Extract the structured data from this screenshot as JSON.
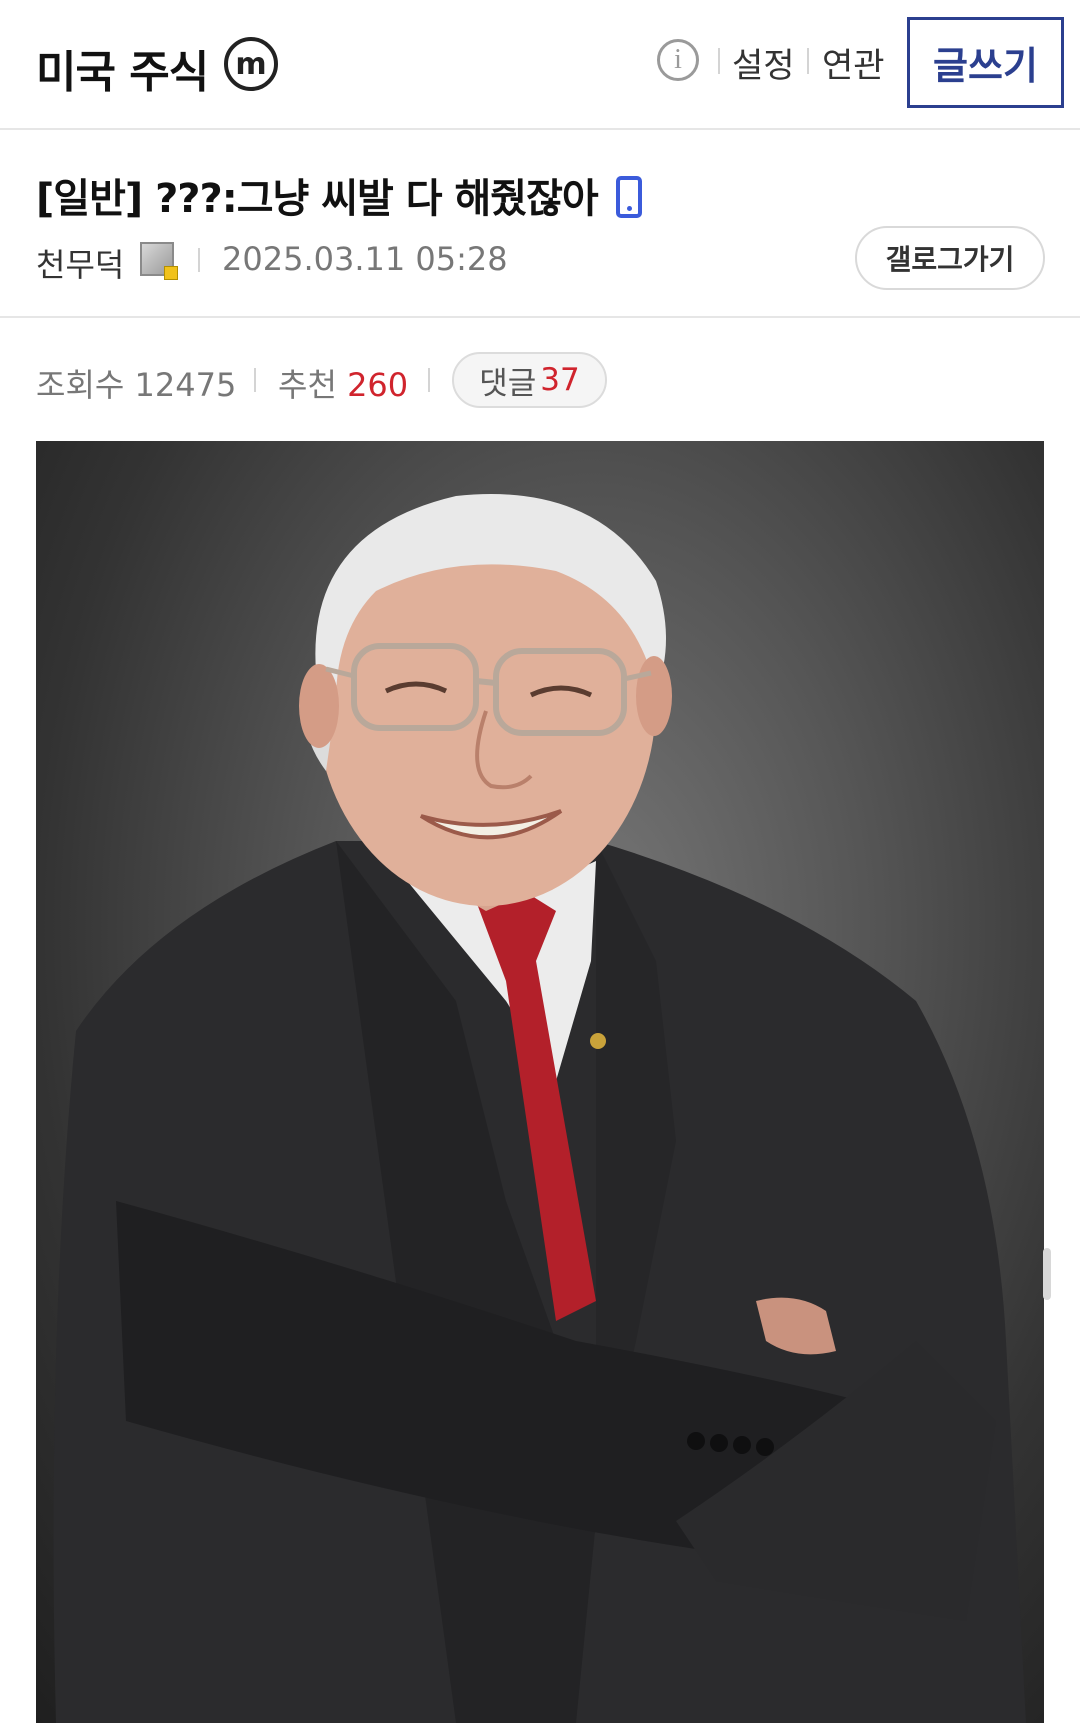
{
  "header": {
    "gallery_title": "미국 주식",
    "minor_badge": "m",
    "links": [
      "설정",
      "연관"
    ],
    "write_button": "글쓰기"
  },
  "post": {
    "title": "[일반] ???:그냥 씨발 다 해줬잖아",
    "author": "천무덕",
    "date": "2025.03.11 05:28",
    "gallery_button": "갤로그가기",
    "views_label": "조회수",
    "views": "12475",
    "recommend_label": "추천",
    "recommend": "260",
    "comments_label": "댓글",
    "comments": "37"
  },
  "colors": {
    "accent": "#2b3f8f",
    "mobile_icon": "#3b5bdb",
    "count_red": "#d0242d"
  },
  "icons": {
    "info": "info-icon",
    "mobile": "mobile-phone-icon",
    "member": "fixed-member-icon"
  },
  "image": {
    "description": "Portrait photograph of an elderly man with white hair and glasses, smiling, wearing a dark suit and red tie, arms crossed, against a grey studio background"
  }
}
